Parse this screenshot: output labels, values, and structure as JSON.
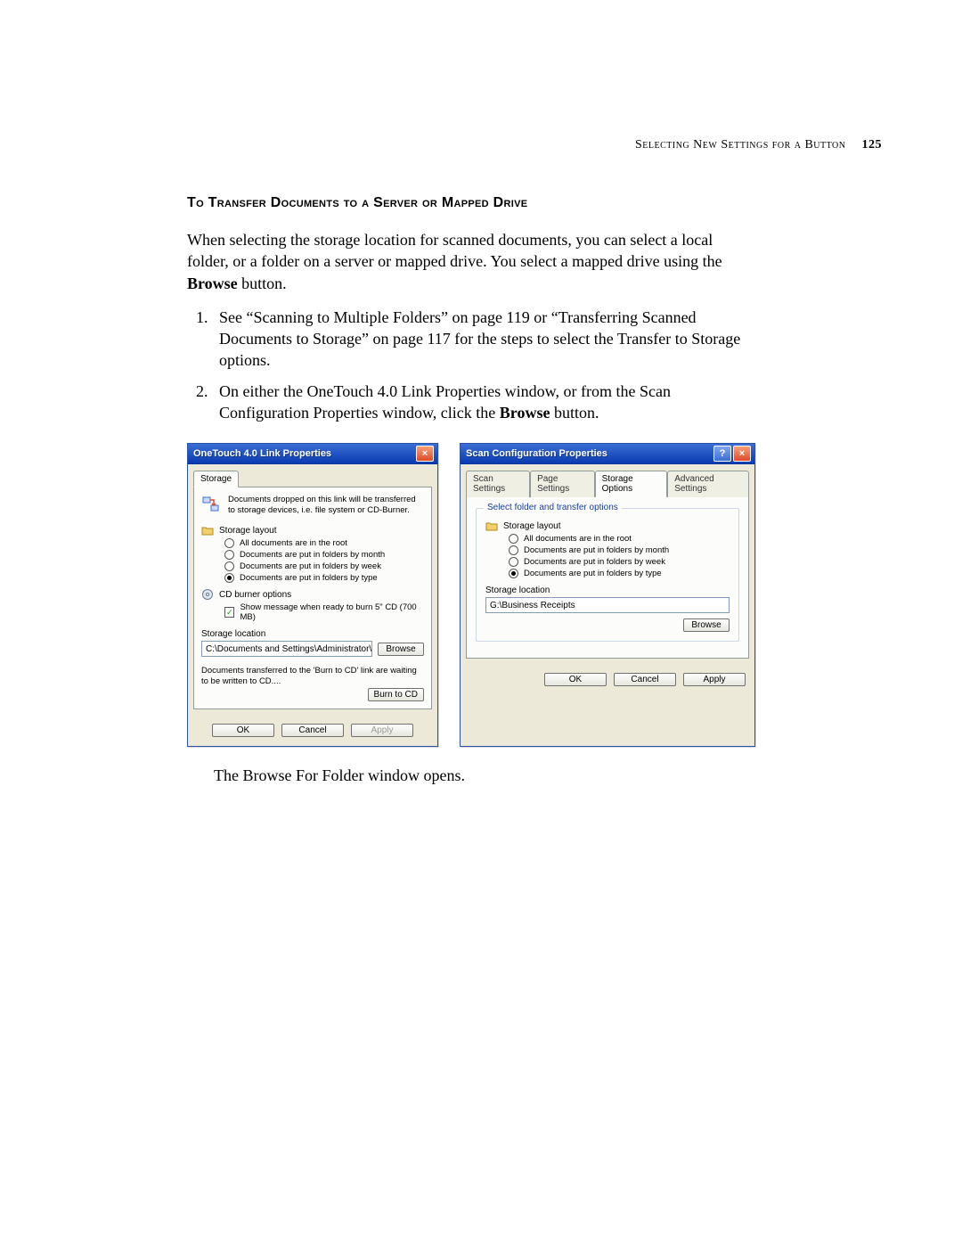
{
  "header": {
    "running": "Selecting New Settings for a Button",
    "page_number": "125"
  },
  "section": {
    "title": "To Transfer Documents to a Server or Mapped Drive",
    "intro_a": "When selecting the storage location for scanned documents, you can select a local folder, or a folder on a server or mapped drive. You select a mapped drive using the ",
    "intro_bold": "Browse",
    "intro_c": " button.",
    "step1": "See “Scanning to Multiple Folders” on page 119 or “Transferring Scanned Documents to Storage” on page 117 for the steps to select the Transfer to Storage options.",
    "step2_a": "On either the OneTouch 4.0 Link Properties window, or from the Scan Configuration Properties window, click the ",
    "step2_bold": "Browse",
    "step2_c": " button.",
    "after_dialogs": "The Browse For Folder window opens."
  },
  "dlg1": {
    "title": "OneTouch 4.0 Link Properties",
    "tab": "Storage",
    "intro": "Documents dropped on this link will be transferred to storage devices, i.e. file system or CD-Burner.",
    "group1": "Storage layout",
    "opts": {
      "o1": "All documents are in the root",
      "o2": "Documents are put in folders by month",
      "o3": "Documents are put in folders by week",
      "o4": "Documents are put in folders by type"
    },
    "group2": "CD burner options",
    "cb1": "Show message when ready to burn 5\" CD (700 MB)",
    "storage_lbl": "Storage location",
    "path": "C:\\Documents and Settings\\Administrator\\My Do",
    "browse": "Browse",
    "note": "Documents transferred to the 'Burn to CD' link are waiting to be written to CD....",
    "burn": "Burn to CD",
    "ok": "OK",
    "cancel": "Cancel",
    "apply": "Apply"
  },
  "dlg2": {
    "title": "Scan Configuration Properties",
    "tabs": {
      "t1": "Scan Settings",
      "t2": "Page Settings",
      "t3": "Storage Options",
      "t4": "Advanced Settings"
    },
    "legend": "Select folder and transfer options",
    "group1": "Storage layout",
    "opts": {
      "o1": "All documents are in the root",
      "o2": "Documents are put in folders by month",
      "o3": "Documents are put in folders by week",
      "o4": "Documents are put in folders by type"
    },
    "storage_lbl": "Storage location",
    "path": "G:\\Business Receipts",
    "browse": "Browse",
    "ok": "OK",
    "cancel": "Cancel",
    "apply": "Apply"
  }
}
